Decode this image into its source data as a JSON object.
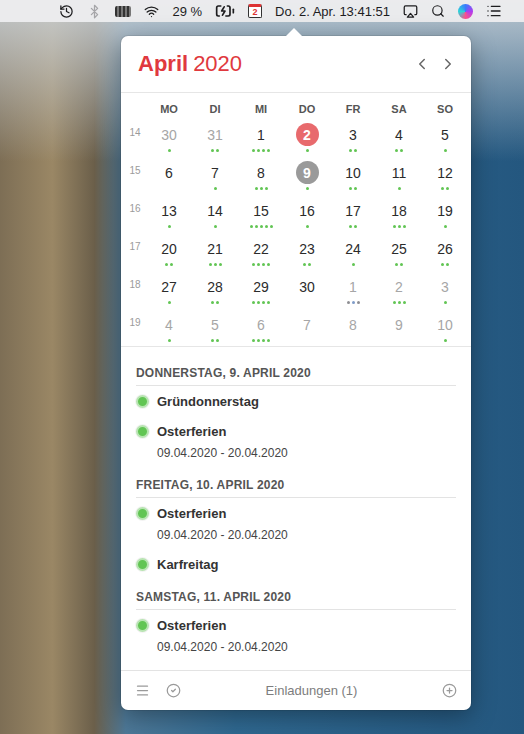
{
  "menubar": {
    "battery_percent": "29 %",
    "battery_charging": true,
    "calendar_day": "2",
    "clock": "Do. 2. Apr. 13:41:51",
    "bluetooth_on": false
  },
  "calendar": {
    "month": "April",
    "year": "2020",
    "weekdays": [
      "MO",
      "DI",
      "MI",
      "DO",
      "FR",
      "SA",
      "SO"
    ],
    "weeks": [
      {
        "number": "14",
        "days": [
          {
            "day": "30",
            "in_month": false,
            "today": false,
            "selected": false,
            "dots": [
              "#62c554"
            ]
          },
          {
            "day": "31",
            "in_month": false,
            "today": false,
            "selected": false,
            "dots": [
              "#62c554",
              "#62c554"
            ]
          },
          {
            "day": "1",
            "in_month": true,
            "today": false,
            "selected": false,
            "dots": [
              "#62c554",
              "#62c554",
              "#62c554",
              "#62c554"
            ]
          },
          {
            "day": "2",
            "in_month": true,
            "today": true,
            "selected": false,
            "dots": [
              "#62c554"
            ]
          },
          {
            "day": "3",
            "in_month": true,
            "today": false,
            "selected": false,
            "dots": [
              "#62c554",
              "#62c554"
            ]
          },
          {
            "day": "4",
            "in_month": true,
            "today": false,
            "selected": false,
            "dots": [
              "#62c554",
              "#62c554"
            ]
          },
          {
            "day": "5",
            "in_month": true,
            "today": false,
            "selected": false,
            "dots": [
              "#62c554"
            ]
          }
        ]
      },
      {
        "number": "15",
        "days": [
          {
            "day": "6",
            "in_month": true,
            "today": false,
            "selected": false,
            "dots": []
          },
          {
            "day": "7",
            "in_month": true,
            "today": false,
            "selected": false,
            "dots": [
              "#62c554"
            ]
          },
          {
            "day": "8",
            "in_month": true,
            "today": false,
            "selected": false,
            "dots": [
              "#62c554",
              "#62c554",
              "#62c554"
            ]
          },
          {
            "day": "9",
            "in_month": true,
            "today": false,
            "selected": true,
            "dots": [
              "#62c554"
            ]
          },
          {
            "day": "10",
            "in_month": true,
            "today": false,
            "selected": false,
            "dots": [
              "#62c554",
              "#62c554"
            ]
          },
          {
            "day": "11",
            "in_month": true,
            "today": false,
            "selected": false,
            "dots": [
              "#62c554"
            ]
          },
          {
            "day": "12",
            "in_month": true,
            "today": false,
            "selected": false,
            "dots": [
              "#62c554",
              "#62c554"
            ]
          }
        ]
      },
      {
        "number": "16",
        "days": [
          {
            "day": "13",
            "in_month": true,
            "today": false,
            "selected": false,
            "dots": [
              "#62c554"
            ]
          },
          {
            "day": "14",
            "in_month": true,
            "today": false,
            "selected": false,
            "dots": [
              "#62c554"
            ]
          },
          {
            "day": "15",
            "in_month": true,
            "today": false,
            "selected": false,
            "dots": [
              "#62c554",
              "#62c554",
              "#62c554",
              "#62c554",
              "#62c554"
            ]
          },
          {
            "day": "16",
            "in_month": true,
            "today": false,
            "selected": false,
            "dots": [
              "#62c554"
            ]
          },
          {
            "day": "17",
            "in_month": true,
            "today": false,
            "selected": false,
            "dots": [
              "#62c554",
              "#62c554"
            ]
          },
          {
            "day": "18",
            "in_month": true,
            "today": false,
            "selected": false,
            "dots": [
              "#62c554",
              "#62c554",
              "#62c554"
            ]
          },
          {
            "day": "19",
            "in_month": true,
            "today": false,
            "selected": false,
            "dots": [
              "#62c554"
            ]
          }
        ]
      },
      {
        "number": "17",
        "days": [
          {
            "day": "20",
            "in_month": true,
            "today": false,
            "selected": false,
            "dots": [
              "#62c554",
              "#62c554"
            ]
          },
          {
            "day": "21",
            "in_month": true,
            "today": false,
            "selected": false,
            "dots": [
              "#62c554",
              "#62c554",
              "#62c554"
            ]
          },
          {
            "day": "22",
            "in_month": true,
            "today": false,
            "selected": false,
            "dots": [
              "#62c554",
              "#62c554",
              "#62c554",
              "#62c554"
            ]
          },
          {
            "day": "23",
            "in_month": true,
            "today": false,
            "selected": false,
            "dots": [
              "#62c554",
              "#62c554"
            ]
          },
          {
            "day": "24",
            "in_month": true,
            "today": false,
            "selected": false,
            "dots": [
              "#62c554"
            ]
          },
          {
            "day": "25",
            "in_month": true,
            "today": false,
            "selected": false,
            "dots": [
              "#62c554",
              "#62c554"
            ]
          },
          {
            "day": "26",
            "in_month": true,
            "today": false,
            "selected": false,
            "dots": [
              "#62c554",
              "#62c554"
            ]
          }
        ]
      },
      {
        "number": "18",
        "days": [
          {
            "day": "27",
            "in_month": true,
            "today": false,
            "selected": false,
            "dots": [
              "#62c554"
            ]
          },
          {
            "day": "28",
            "in_month": true,
            "today": false,
            "selected": false,
            "dots": [
              "#62c554",
              "#62c554"
            ]
          },
          {
            "day": "29",
            "in_month": true,
            "today": false,
            "selected": false,
            "dots": [
              "#62c554",
              "#62c554",
              "#62c554",
              "#62c554"
            ]
          },
          {
            "day": "30",
            "in_month": true,
            "today": false,
            "selected": false,
            "dots": []
          },
          {
            "day": "1",
            "in_month": false,
            "today": false,
            "selected": false,
            "dots": [
              "#8e8e93",
              "#7f9cc8",
              "#8e8e93"
            ]
          },
          {
            "day": "2",
            "in_month": false,
            "today": false,
            "selected": false,
            "dots": [
              "#62c554",
              "#62c554",
              "#62c554"
            ]
          },
          {
            "day": "3",
            "in_month": false,
            "today": false,
            "selected": false,
            "dots": [
              "#62c554"
            ]
          }
        ]
      },
      {
        "number": "19",
        "days": [
          {
            "day": "4",
            "in_month": false,
            "today": false,
            "selected": false,
            "dots": [
              "#62c554"
            ]
          },
          {
            "day": "5",
            "in_month": false,
            "today": false,
            "selected": false,
            "dots": [
              "#62c554",
              "#62c554"
            ]
          },
          {
            "day": "6",
            "in_month": false,
            "today": false,
            "selected": false,
            "dots": [
              "#62c554",
              "#62c554",
              "#62c554",
              "#62c554"
            ]
          },
          {
            "day": "7",
            "in_month": false,
            "today": false,
            "selected": false,
            "dots": []
          },
          {
            "day": "8",
            "in_month": false,
            "today": false,
            "selected": false,
            "dots": []
          },
          {
            "day": "9",
            "in_month": false,
            "today": false,
            "selected": false,
            "dots": []
          },
          {
            "day": "10",
            "in_month": false,
            "today": false,
            "selected": false,
            "dots": [
              "#62c554"
            ]
          }
        ]
      }
    ]
  },
  "agenda": [
    {
      "date": "DONNERSTAG, 9. APRIL 2020",
      "events": [
        {
          "title": "Gründonnerstag",
          "color": "#62c554"
        },
        {
          "title": "Osterferien",
          "range": "09.04.2020 - 20.04.2020",
          "color": "#62c554"
        }
      ]
    },
    {
      "date": "FREITAG, 10. APRIL 2020",
      "events": [
        {
          "title": "Osterferien",
          "range": "09.04.2020 - 20.04.2020",
          "color": "#62c554"
        },
        {
          "title": "Karfreitag",
          "color": "#62c554"
        }
      ]
    },
    {
      "date": "SAMSTAG, 11. APRIL 2020",
      "events": [
        {
          "title": "Osterferien",
          "range": "09.04.2020 - 20.04.2020",
          "color": "#62c554"
        }
      ]
    }
  ],
  "footer": {
    "invitations": "Einladungen (1)"
  }
}
